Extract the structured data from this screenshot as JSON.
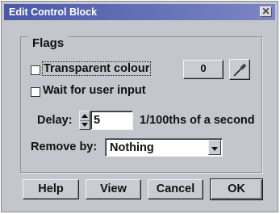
{
  "window": {
    "title": "Edit Control Block",
    "close_glyph": "✕"
  },
  "flags": {
    "group_label": "Flags",
    "transparent_label": "Transparent colour",
    "transparent_checked": false,
    "wait_label": "Wait for user input",
    "wait_checked": false,
    "colour_value": "0",
    "picker_icon": "eyedropper-icon"
  },
  "delay": {
    "label": "Delay:",
    "value": "5",
    "unit": "1/100ths of a second"
  },
  "remove_by": {
    "label": "Remove by:",
    "selected": "Nothing"
  },
  "buttons": {
    "help": "Help",
    "view": "View",
    "cancel": "Cancel",
    "ok": "OK"
  }
}
